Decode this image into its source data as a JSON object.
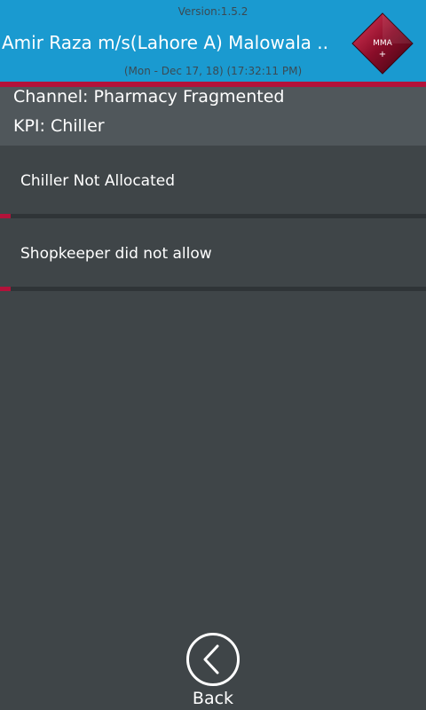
{
  "header": {
    "version": "Version:1.5.2",
    "user_title": "Amir Raza m/s(Lahore A) Malowala ..",
    "datetime": "(Mon - Dec 17, 18) (17:32:11 PM)",
    "logo_text": "MMA",
    "logo_plus": "+",
    "accent_color": "#b3123a",
    "header_color": "#1a9ad0"
  },
  "info": {
    "channel": "Channel: Pharmacy Fragmented",
    "kpi": "KPI: Chiller"
  },
  "list": {
    "items": [
      {
        "label": "Chiller Not Allocated"
      },
      {
        "label": "Shopkeeper did not allow"
      }
    ]
  },
  "footer": {
    "back_label": "Back",
    "back_icon": "chevron-left-circle-icon"
  }
}
